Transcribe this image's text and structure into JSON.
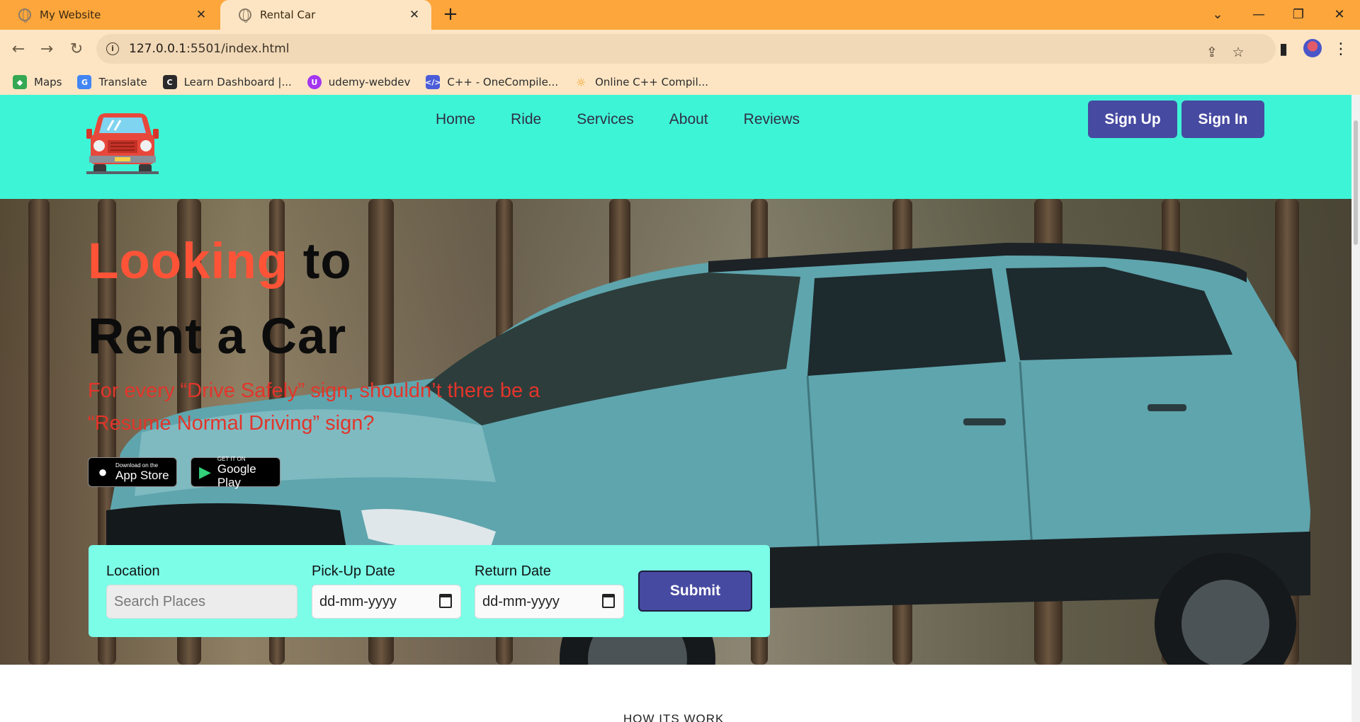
{
  "browser": {
    "tabs": [
      {
        "title": "My Website",
        "active": false
      },
      {
        "title": "Rental Car",
        "active": true
      }
    ],
    "url_host": "127.0.0.1",
    "url_rest": ":5501/index.html",
    "bookmarks": [
      {
        "label": "Maps",
        "icon": "maps-icon",
        "color": "#34a853"
      },
      {
        "label": "Translate",
        "icon": "translate-icon",
        "color": "#4285f4"
      },
      {
        "label": "Learn Dashboard |...",
        "icon": "codecademy-icon",
        "color": "#2b2b2b"
      },
      {
        "label": "udemy-webdev",
        "icon": "udemy-icon",
        "color": "#a435f0"
      },
      {
        "label": "C++ - OneCompile...",
        "icon": "onecompiler-icon",
        "color": "#4a5cd8"
      },
      {
        "label": "Online C++ Compil...",
        "icon": "sun-icon",
        "color": "#f29b1d"
      }
    ]
  },
  "site": {
    "nav": [
      "Home",
      "Ride",
      "Services",
      "About",
      "Reviews"
    ],
    "sign_up": "Sign Up",
    "sign_in": "Sign In",
    "hero": {
      "title_accent": "Looking",
      "title_rest_line1": " to",
      "title_line2": "Rent a Car",
      "subtitle": "For every “Drive Safely” sign, shouldn’t there be a “Resume Normal Driving” sign?",
      "appstore_small": "Download on the",
      "appstore_big": "App Store",
      "googleplay_small": "GET IT ON",
      "googleplay_big": "Google Play"
    },
    "form": {
      "location_label": "Location",
      "location_placeholder": "Search Places",
      "pickup_label": "Pick-Up Date",
      "pickup_value": "dd-mm-yyyy",
      "return_label": "Return Date",
      "return_value": "dd-mm-yyyy",
      "submit": "Submit"
    },
    "next_section_heading": "HOW ITS WORK"
  },
  "colors": {
    "tabbar": "#fda63b",
    "navbar": "#3ef4d6",
    "form_bg": "#7cfde8",
    "button": "#474aa1",
    "accent": "#ff5338",
    "subtitle": "#e2352b"
  }
}
